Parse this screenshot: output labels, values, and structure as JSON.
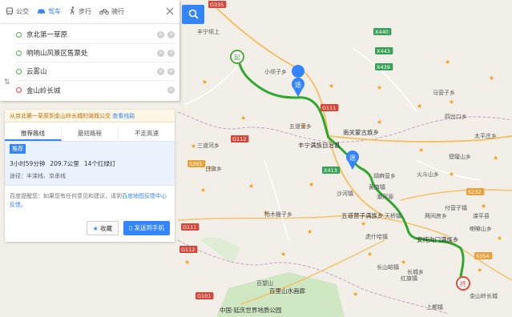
{
  "modes": [
    {
      "label": "公交",
      "icon": "bus-icon"
    },
    {
      "label": "驾车",
      "icon": "car-icon",
      "active": true
    },
    {
      "label": "步行",
      "icon": "walk-icon"
    },
    {
      "label": "骑行",
      "icon": "bike-icon"
    }
  ],
  "stops": [
    {
      "name": "京北第一草原",
      "type": "start"
    },
    {
      "name": "响响山风景区售票处",
      "type": "via"
    },
    {
      "name": "云雾山",
      "type": "via"
    },
    {
      "name": "金山岭长城",
      "type": "end"
    }
  ],
  "notice": {
    "text": "从京北第一草原到金山岭长城的骑城公交",
    "link": "查看线路"
  },
  "tabs": [
    "推荐路线",
    "最短路程",
    "不走高速"
  ],
  "route": {
    "badge": "推荐",
    "duration": "3小时59分钟",
    "distance": "209.7公里",
    "lights": "14个红绿灯",
    "via": "途径：丰滦线、京承线"
  },
  "feedback": {
    "text": "百度提醒您：如果您有任何意见和建议，请到",
    "link": "百度地图反馈中心反馈",
    "end": "。"
  },
  "buttons": {
    "fav": "收藏",
    "send": "发送到手机"
  },
  "markers": {
    "start": "起",
    "via": "途",
    "end": "终"
  },
  "map_labels": [
    {
      "t": "G335",
      "kind": "road"
    },
    {
      "t": "丰宁坝上",
      "kind": "place"
    },
    {
      "t": "X440",
      "kind": "road"
    },
    {
      "t": "X443",
      "kind": "road"
    },
    {
      "t": "X439",
      "kind": "road"
    },
    {
      "t": "小坝子乡",
      "kind": "place"
    },
    {
      "t": "G111",
      "kind": "road"
    },
    {
      "t": "五道营乡",
      "kind": "place"
    },
    {
      "t": "三道河乡",
      "kind": "place"
    },
    {
      "t": "G112",
      "kind": "road"
    },
    {
      "t": "丰宁满族自治县",
      "kind": "place"
    },
    {
      "t": "南关蒙古族乡",
      "kind": "place"
    },
    {
      "t": "X413",
      "kind": "road"
    },
    {
      "t": "S265",
      "kind": "road"
    },
    {
      "t": "白旗乡",
      "kind": "place"
    },
    {
      "t": "胡麻营乡",
      "kind": "place"
    },
    {
      "t": "窟窿山乡",
      "kind": "place"
    },
    {
      "t": "潮河源",
      "kind": "place"
    },
    {
      "t": "黄旗镇",
      "kind": "place"
    },
    {
      "t": "杨木栅子乡",
      "kind": "place"
    },
    {
      "t": "天桥镇",
      "kind": "place"
    },
    {
      "t": "五道营子满族乡",
      "kind": "place"
    },
    {
      "t": "虎什哈镇",
      "kind": "place"
    },
    {
      "t": "安纯沟门满族乡",
      "kind": "place"
    },
    {
      "t": "两间房乡",
      "kind": "place"
    },
    {
      "t": "滦平县",
      "kind": "place"
    },
    {
      "t": "长山峪镇",
      "kind": "place"
    },
    {
      "t": "红旗镇",
      "kind": "place"
    },
    {
      "t": "百望山",
      "kind": "place"
    },
    {
      "t": "百里山水画廊",
      "kind": "place"
    },
    {
      "t": "金山岭长城",
      "kind": "place"
    },
    {
      "t": "中国·延庆世界地质公园",
      "kind": "place"
    },
    {
      "t": "G112",
      "kind": "road"
    },
    {
      "t": "G111",
      "kind": "road"
    },
    {
      "t": "G101",
      "kind": "road"
    },
    {
      "t": "S232",
      "kind": "road"
    },
    {
      "t": "S354",
      "kind": "road"
    },
    {
      "t": "太平庄乡",
      "kind": "place"
    },
    {
      "t": "四岔口乡",
      "kind": "place"
    },
    {
      "t": "马营子乡",
      "kind": "place"
    },
    {
      "t": "付营子镇",
      "kind": "place"
    },
    {
      "t": "喇嘛山乡",
      "kind": "place"
    },
    {
      "t": "长城乡",
      "kind": "place"
    },
    {
      "t": "火斗山乡",
      "kind": "place"
    },
    {
      "t": "上都镇",
      "kind": "place"
    },
    {
      "t": "沙河镇",
      "kind": "place"
    }
  ]
}
